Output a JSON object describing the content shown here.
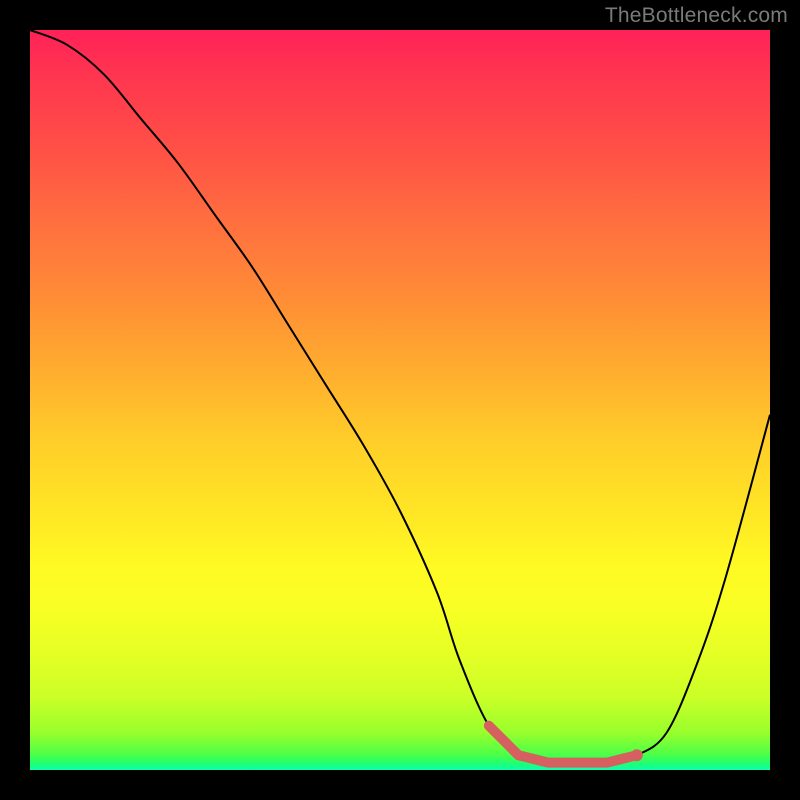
{
  "watermark": "TheBottleneck.com",
  "chart_data": {
    "type": "line",
    "title": "",
    "xlabel": "",
    "ylabel": "",
    "xlim": [
      0,
      100
    ],
    "ylim": [
      0,
      100
    ],
    "gradient": {
      "orientation": "vertical",
      "stops": [
        {
          "pos": 0,
          "color": "#ff2158"
        },
        {
          "pos": 50,
          "color": "#ffc029"
        },
        {
          "pos": 80,
          "color": "#f5ff24"
        },
        {
          "pos": 100,
          "color": "#0cffb3"
        }
      ],
      "meaning": "top (red) = high bottleneck, bottom (green) = low bottleneck"
    },
    "series": [
      {
        "name": "bottleneck-curve",
        "x": [
          0,
          5,
          10,
          15,
          20,
          25,
          30,
          35,
          40,
          45,
          50,
          55,
          58,
          62,
          66,
          70,
          74,
          78,
          82,
          86,
          90,
          94,
          100
        ],
        "y": [
          100,
          98,
          94,
          88,
          82,
          75,
          68,
          60,
          52,
          44,
          35,
          24,
          15,
          6,
          2,
          1,
          1,
          1,
          2,
          5,
          14,
          26,
          48
        ]
      }
    ],
    "optimal_range": {
      "x_start": 62,
      "x_end": 82,
      "y": 1
    },
    "annotations": []
  }
}
